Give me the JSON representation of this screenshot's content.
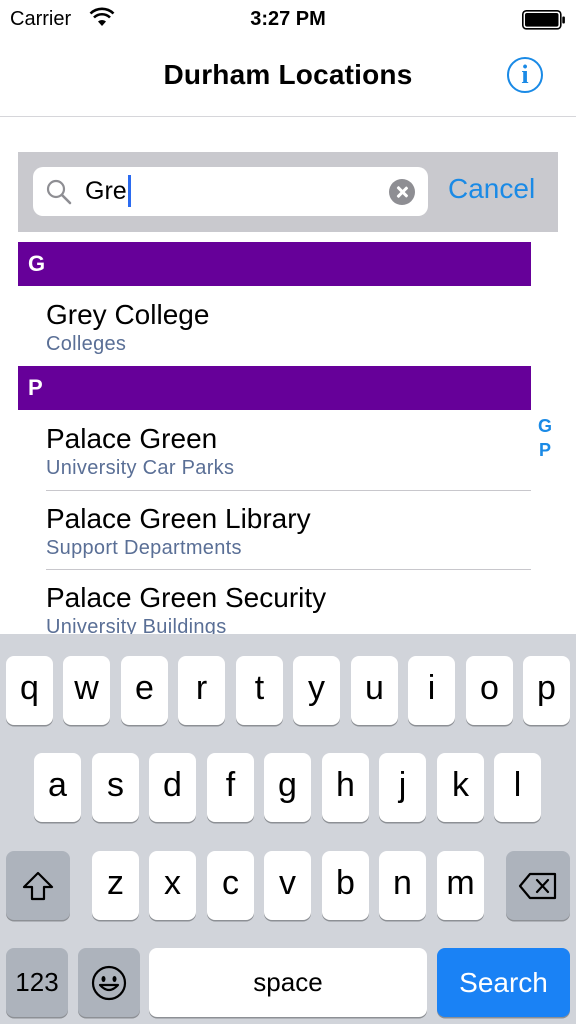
{
  "status_bar": {
    "carrier": "Carrier",
    "time": "3:27 PM"
  },
  "nav": {
    "title": "Durham Locations",
    "info_icon": "info-icon"
  },
  "search": {
    "query": "Gre",
    "cancel_label": "Cancel"
  },
  "sections": [
    {
      "letter": "G",
      "rows": [
        {
          "title": "Grey College",
          "subtitle": "Colleges"
        }
      ]
    },
    {
      "letter": "P",
      "rows": [
        {
          "title": "Palace Green",
          "subtitle": "University Car Parks"
        },
        {
          "title": "Palace Green Library",
          "subtitle": "Support Departments"
        },
        {
          "title": "Palace Green Security",
          "subtitle": "University Buildings"
        }
      ]
    }
  ],
  "index": [
    "G",
    "P"
  ],
  "keyboard": {
    "row1": [
      "q",
      "w",
      "e",
      "r",
      "t",
      "y",
      "u",
      "i",
      "o",
      "p"
    ],
    "row2": [
      "a",
      "s",
      "d",
      "f",
      "g",
      "h",
      "j",
      "k",
      "l"
    ],
    "row3": [
      "z",
      "x",
      "c",
      "v",
      "b",
      "n",
      "m"
    ],
    "num_label": "123",
    "space_label": "space",
    "search_label": "Search"
  },
  "colors": {
    "accent": "#1a8ae6",
    "section_header": "#660099",
    "subtitle": "#5a6f96",
    "search_key": "#1a82f5"
  }
}
